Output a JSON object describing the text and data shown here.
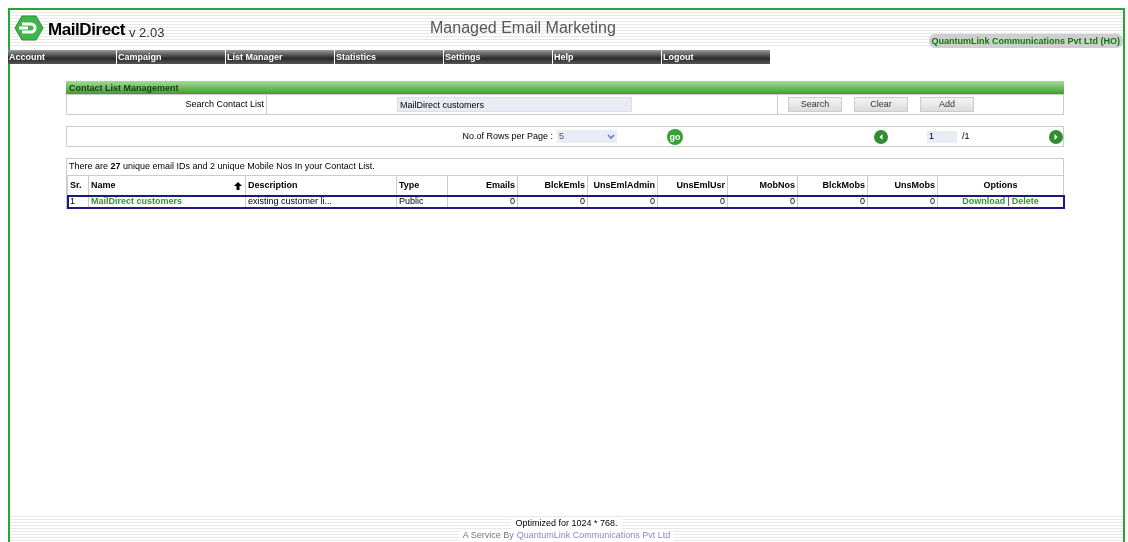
{
  "header": {
    "product": "MailDirect",
    "version": "v 2.03",
    "title": "Managed Email Marketing",
    "company": "QuantumLink Communications Pvt Ltd (HO)"
  },
  "menu": [
    "Account",
    "Campaign",
    "List Manager",
    "Statistics",
    "Settings",
    "Help",
    "Logout"
  ],
  "panel": {
    "title": "Contact List Management",
    "search_label": "Search Contact List",
    "search_value": "MailDirect customers",
    "buttons": [
      "Search",
      "Clear",
      "Add"
    ]
  },
  "pager": {
    "rows_label": "No.of Rows per Page :",
    "rows_value": "5",
    "go": "go",
    "page": "1",
    "total": "/1"
  },
  "summary": "There are **27** unique email IDs and 2 unique Mobile Nos In your Contact List.",
  "table": {
    "columns": [
      {
        "label": "Sr.",
        "sorted": false
      },
      {
        "label": "Name",
        "sorted": true
      },
      {
        "label": "Description",
        "sorted": false
      },
      {
        "label": "Type",
        "sorted": false
      },
      {
        "label": "Emails",
        "sorted": false
      },
      {
        "label": "BlckEmls",
        "sorted": false
      },
      {
        "label": "UnsEmlAdmin",
        "sorted": false
      },
      {
        "label": "UnsEmlUsr",
        "sorted": false
      },
      {
        "label": "MobNos",
        "sorted": false
      },
      {
        "label": "BlckMobs",
        "sorted": false
      },
      {
        "label": "UnsMobs",
        "sorted": false
      },
      {
        "label": "Options",
        "sorted": false
      }
    ],
    "rows": [
      {
        "selected": true,
        "cells": [
          "1",
          "MailDirect customers",
          "existing customer li...",
          "Public",
          "0",
          "0",
          "0",
          "0",
          "0",
          "0",
          "0"
        ],
        "actions": [
          "Download",
          "Delete"
        ],
        "separator": "|"
      }
    ]
  },
  "footer": {
    "optimized": "Optimized for 1024 * 768.",
    "service": "A Service By",
    "service_link": "QuantumLink Communications Pvt Ltd"
  }
}
